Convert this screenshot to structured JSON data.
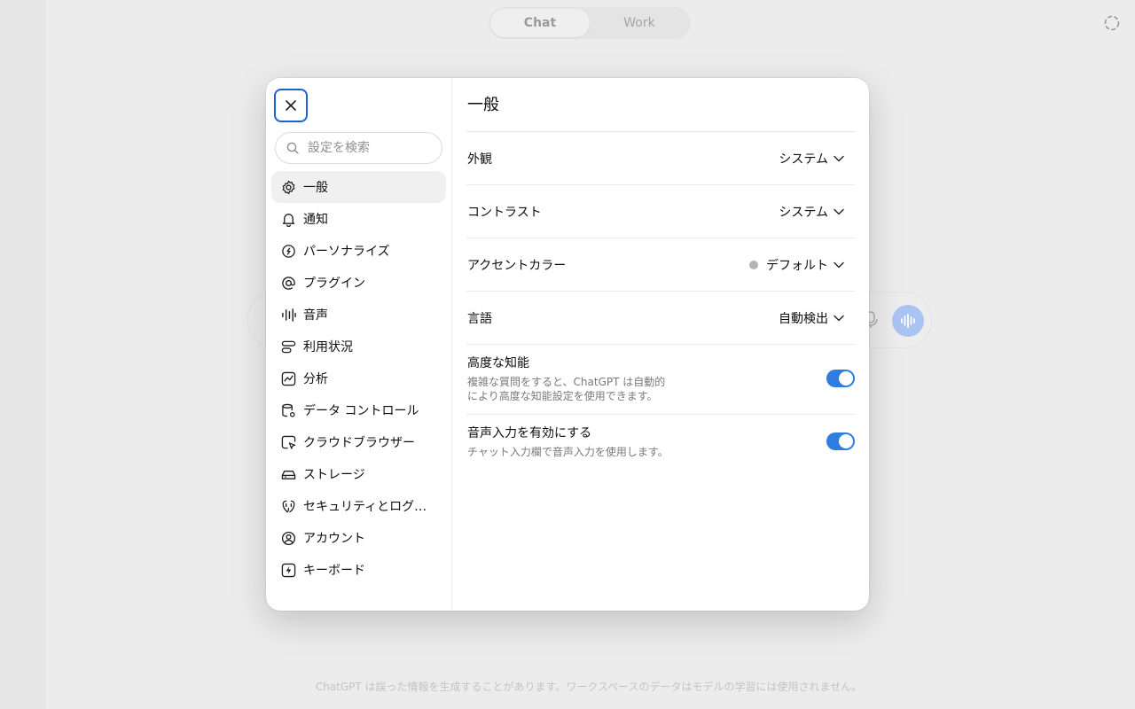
{
  "background": {
    "mode_tabs": [
      {
        "label": "Chat",
        "active": true
      },
      {
        "label": "Work",
        "active": false
      }
    ],
    "footer_disclaimer": "ChatGPT は誤った情報を生成することがあります。ワークスペースのデータはモデルの学習には使用されません。"
  },
  "settings": {
    "close_icon": "x-icon",
    "search": {
      "placeholder": "設定を検索",
      "value": ""
    },
    "nav": [
      {
        "label": "一般",
        "icon": "gear-icon",
        "active": true
      },
      {
        "label": "通知",
        "icon": "bell-icon"
      },
      {
        "label": "パーソナライズ",
        "icon": "personalize-icon"
      },
      {
        "label": "プラグイン",
        "icon": "at-icon"
      },
      {
        "label": "音声",
        "icon": "waveform-icon"
      },
      {
        "label": "利用状況",
        "icon": "usage-icon"
      },
      {
        "label": "分析",
        "icon": "analytics-icon"
      },
      {
        "label": "データ コントロール",
        "icon": "database-gear-icon"
      },
      {
        "label": "クラウドブラウザー",
        "icon": "browser-cursor-icon"
      },
      {
        "label": "ストレージ",
        "icon": "drive-icon"
      },
      {
        "label": "セキュリティとログイン",
        "icon": "shield-icon"
      },
      {
        "label": "アカウント",
        "icon": "user-circle-icon"
      },
      {
        "label": "キーボード",
        "icon": "lightning-icon"
      }
    ],
    "general": {
      "title": "一般",
      "rows": [
        {
          "label": "外観",
          "value": "システム"
        },
        {
          "label": "コントラスト",
          "value": "システム"
        },
        {
          "label": "アクセントカラー",
          "value": "デフォルト",
          "dot_color": "#b4b4b4"
        },
        {
          "label": "言語",
          "value": "自動検出"
        }
      ],
      "toggles": [
        {
          "title": "高度な知能",
          "description": "複雑な質問をすると、ChatGPT は自動的により高度な知能設定を使用できます。",
          "on": true
        },
        {
          "title": "音声入力を有効にする",
          "description": "チャット入力欄で音声入力を使用します。",
          "on": true
        }
      ]
    }
  },
  "colors": {
    "accent": "#2f7de1",
    "focus_ring": "#1a62d6"
  }
}
